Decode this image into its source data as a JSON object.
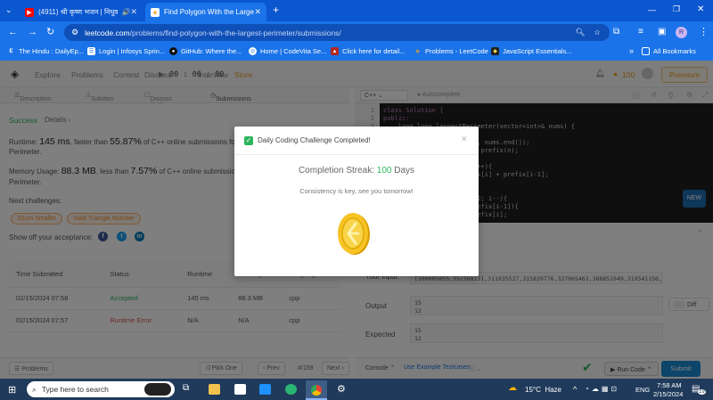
{
  "browser": {
    "tabs": [
      {
        "title": "(4911) श्री कृष्ण भजन | निधुवन",
        "active": false
      },
      {
        "title": "Find Polygon With the Largest P",
        "active": true
      }
    ],
    "url_host": "leetcode.com",
    "url_path": "/problems/find-polygon-with-the-largest-perimeter/submissions/",
    "bookmarks": [
      "The Hindu : DailyEp...",
      "Login | Infosys Sprin...",
      "GitHub: Where the...",
      "Home | CodeVita Se...",
      "Click here for detail...",
      "Problems - LeetCode",
      "JavaScript Essentials..."
    ],
    "all_bookmarks": "All Bookmarks",
    "profile_letter": "R"
  },
  "leetcode": {
    "nav": {
      "explore": "Explore",
      "problems": "Problems",
      "contest": "Contest",
      "discuss": "Discuss",
      "interview": "Interview",
      "store": "Store",
      "timer": "00 : 00 : 00",
      "coins": "100",
      "premium": "Premium"
    },
    "desc_tabs": {
      "description": "Description",
      "solution": "Solution",
      "discuss": "Discuss (340)",
      "submissions": "Submissions"
    },
    "result": {
      "status": "Success",
      "details": "Details",
      "runtime_label": "Runtime:",
      "runtime_value": "145 ms",
      "runtime_mid": ", faster than",
      "runtime_pct": "55.87%",
      "runtime_tail": "of C++ online submissions for Find",
      "runtime_tail2": "Perimeter.",
      "memory_label": "Memory Usage:",
      "memory_value": "88.3 MB",
      "memory_mid": ", less than",
      "memory_pct": "7.57%",
      "memory_tail": "of C++ online submissions for Find",
      "memory_tail2": "Perimeter.",
      "next_label": "Next challenges:",
      "challenges": [
        "3Sum Smaller",
        "Valid Triangle Number"
      ],
      "share_label": "Show off your acceptance:"
    },
    "table": {
      "headers": [
        "Time Submitted",
        "Status",
        "Runtime",
        "Memory",
        "Language"
      ],
      "rows": [
        {
          "time": "02/15/2024 07:58",
          "status": "Accepted",
          "runtime": "145 ms",
          "memory": "88.3 MB",
          "lang": "cpp"
        },
        {
          "time": "02/15/2024 07:57",
          "status": "Runtime Error",
          "runtime": "N/A",
          "memory": "N/A",
          "lang": "cpp"
        }
      ]
    },
    "footer_left": {
      "problems": "Problems",
      "pick": "Pick One",
      "prev": "Prev",
      "page": "#/159",
      "next": "Next"
    },
    "editor": {
      "language": "C++",
      "autocomplete": "Autocomplete",
      "code_lines": [
        "class Solution {",
        "public:",
        "    long long largestPerimeter(vector<int>& nums) {",
        "",
        "        sort(nums.begin(), nums.end());",
        "        vector<long long> prefix(n);",
        "",
        "        for(int i=1;i<n;i++){",
        "            prefix[i]=nums[i] + prefix[i-1];",
        "",
        "",
        "        for(int i=n-1;i>=2; i--){",
        "            if(nums[i]<prefix[i-1]){",
        "                return prefix[i];"
      ],
      "line_numbers": [
        "1",
        "2",
        "3",
        "4",
        "5",
        "6",
        "7",
        "8",
        "9",
        "10",
        "11",
        "12",
        "13",
        "14"
      ]
    },
    "console": {
      "input_label": "Your input",
      "input_value": "[300005055,352368231,311935527,315829776,327065463,388851949,319541150,397875604,311309167,3",
      "output_label": "Output",
      "output_values": [
        "15",
        "12"
      ],
      "expected_label": "Expected",
      "expected_values": [
        "15",
        "12"
      ],
      "diff": "Diff",
      "new_badge": "NEW"
    },
    "footer_right": {
      "console": "Console",
      "example": "Use Example Testcases",
      "run": "Run Code",
      "submit": "Submit"
    }
  },
  "modal": {
    "title": "Daily Coding Challenge Completed!",
    "streak_label": "Completion Streak:",
    "streak_value": "100",
    "streak_unit": "Days",
    "message": "Consistency is key, see you tomorrow!"
  },
  "taskbar": {
    "search_placeholder": "Type here to search",
    "weather": "15°C  Haze",
    "lang": "ENG",
    "time": "7:58 AM",
    "date": "2/15/2024",
    "notif_count": "19"
  },
  "colors": {
    "chrome_blue": "#1a73e8",
    "accent_orange": "#f0a020",
    "success_green": "#2db55d",
    "error_red": "#d9534f"
  }
}
